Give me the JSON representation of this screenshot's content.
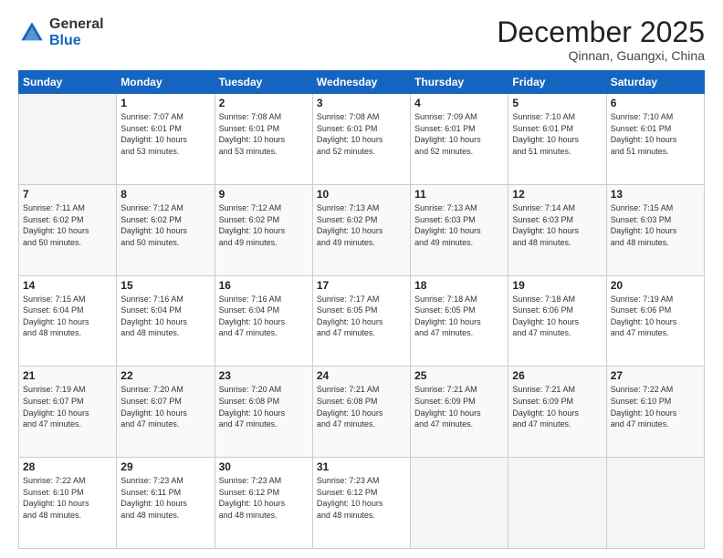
{
  "logo": {
    "general": "General",
    "blue": "Blue"
  },
  "title": "December 2025",
  "location": "Qinnan, Guangxi, China",
  "headers": [
    "Sunday",
    "Monday",
    "Tuesday",
    "Wednesday",
    "Thursday",
    "Friday",
    "Saturday"
  ],
  "weeks": [
    [
      {
        "num": "",
        "info": ""
      },
      {
        "num": "1",
        "info": "Sunrise: 7:07 AM\nSunset: 6:01 PM\nDaylight: 10 hours\nand 53 minutes."
      },
      {
        "num": "2",
        "info": "Sunrise: 7:08 AM\nSunset: 6:01 PM\nDaylight: 10 hours\nand 53 minutes."
      },
      {
        "num": "3",
        "info": "Sunrise: 7:08 AM\nSunset: 6:01 PM\nDaylight: 10 hours\nand 52 minutes."
      },
      {
        "num": "4",
        "info": "Sunrise: 7:09 AM\nSunset: 6:01 PM\nDaylight: 10 hours\nand 52 minutes."
      },
      {
        "num": "5",
        "info": "Sunrise: 7:10 AM\nSunset: 6:01 PM\nDaylight: 10 hours\nand 51 minutes."
      },
      {
        "num": "6",
        "info": "Sunrise: 7:10 AM\nSunset: 6:01 PM\nDaylight: 10 hours\nand 51 minutes."
      }
    ],
    [
      {
        "num": "7",
        "info": "Sunrise: 7:11 AM\nSunset: 6:02 PM\nDaylight: 10 hours\nand 50 minutes."
      },
      {
        "num": "8",
        "info": "Sunrise: 7:12 AM\nSunset: 6:02 PM\nDaylight: 10 hours\nand 50 minutes."
      },
      {
        "num": "9",
        "info": "Sunrise: 7:12 AM\nSunset: 6:02 PM\nDaylight: 10 hours\nand 49 minutes."
      },
      {
        "num": "10",
        "info": "Sunrise: 7:13 AM\nSunset: 6:02 PM\nDaylight: 10 hours\nand 49 minutes."
      },
      {
        "num": "11",
        "info": "Sunrise: 7:13 AM\nSunset: 6:03 PM\nDaylight: 10 hours\nand 49 minutes."
      },
      {
        "num": "12",
        "info": "Sunrise: 7:14 AM\nSunset: 6:03 PM\nDaylight: 10 hours\nand 48 minutes."
      },
      {
        "num": "13",
        "info": "Sunrise: 7:15 AM\nSunset: 6:03 PM\nDaylight: 10 hours\nand 48 minutes."
      }
    ],
    [
      {
        "num": "14",
        "info": "Sunrise: 7:15 AM\nSunset: 6:04 PM\nDaylight: 10 hours\nand 48 minutes."
      },
      {
        "num": "15",
        "info": "Sunrise: 7:16 AM\nSunset: 6:04 PM\nDaylight: 10 hours\nand 48 minutes."
      },
      {
        "num": "16",
        "info": "Sunrise: 7:16 AM\nSunset: 6:04 PM\nDaylight: 10 hours\nand 47 minutes."
      },
      {
        "num": "17",
        "info": "Sunrise: 7:17 AM\nSunset: 6:05 PM\nDaylight: 10 hours\nand 47 minutes."
      },
      {
        "num": "18",
        "info": "Sunrise: 7:18 AM\nSunset: 6:05 PM\nDaylight: 10 hours\nand 47 minutes."
      },
      {
        "num": "19",
        "info": "Sunrise: 7:18 AM\nSunset: 6:06 PM\nDaylight: 10 hours\nand 47 minutes."
      },
      {
        "num": "20",
        "info": "Sunrise: 7:19 AM\nSunset: 6:06 PM\nDaylight: 10 hours\nand 47 minutes."
      }
    ],
    [
      {
        "num": "21",
        "info": "Sunrise: 7:19 AM\nSunset: 6:07 PM\nDaylight: 10 hours\nand 47 minutes."
      },
      {
        "num": "22",
        "info": "Sunrise: 7:20 AM\nSunset: 6:07 PM\nDaylight: 10 hours\nand 47 minutes."
      },
      {
        "num": "23",
        "info": "Sunrise: 7:20 AM\nSunset: 6:08 PM\nDaylight: 10 hours\nand 47 minutes."
      },
      {
        "num": "24",
        "info": "Sunrise: 7:21 AM\nSunset: 6:08 PM\nDaylight: 10 hours\nand 47 minutes."
      },
      {
        "num": "25",
        "info": "Sunrise: 7:21 AM\nSunset: 6:09 PM\nDaylight: 10 hours\nand 47 minutes."
      },
      {
        "num": "26",
        "info": "Sunrise: 7:21 AM\nSunset: 6:09 PM\nDaylight: 10 hours\nand 47 minutes."
      },
      {
        "num": "27",
        "info": "Sunrise: 7:22 AM\nSunset: 6:10 PM\nDaylight: 10 hours\nand 47 minutes."
      }
    ],
    [
      {
        "num": "28",
        "info": "Sunrise: 7:22 AM\nSunset: 6:10 PM\nDaylight: 10 hours\nand 48 minutes."
      },
      {
        "num": "29",
        "info": "Sunrise: 7:23 AM\nSunset: 6:11 PM\nDaylight: 10 hours\nand 48 minutes."
      },
      {
        "num": "30",
        "info": "Sunrise: 7:23 AM\nSunset: 6:12 PM\nDaylight: 10 hours\nand 48 minutes."
      },
      {
        "num": "31",
        "info": "Sunrise: 7:23 AM\nSunset: 6:12 PM\nDaylight: 10 hours\nand 48 minutes."
      },
      {
        "num": "",
        "info": ""
      },
      {
        "num": "",
        "info": ""
      },
      {
        "num": "",
        "info": ""
      }
    ]
  ]
}
